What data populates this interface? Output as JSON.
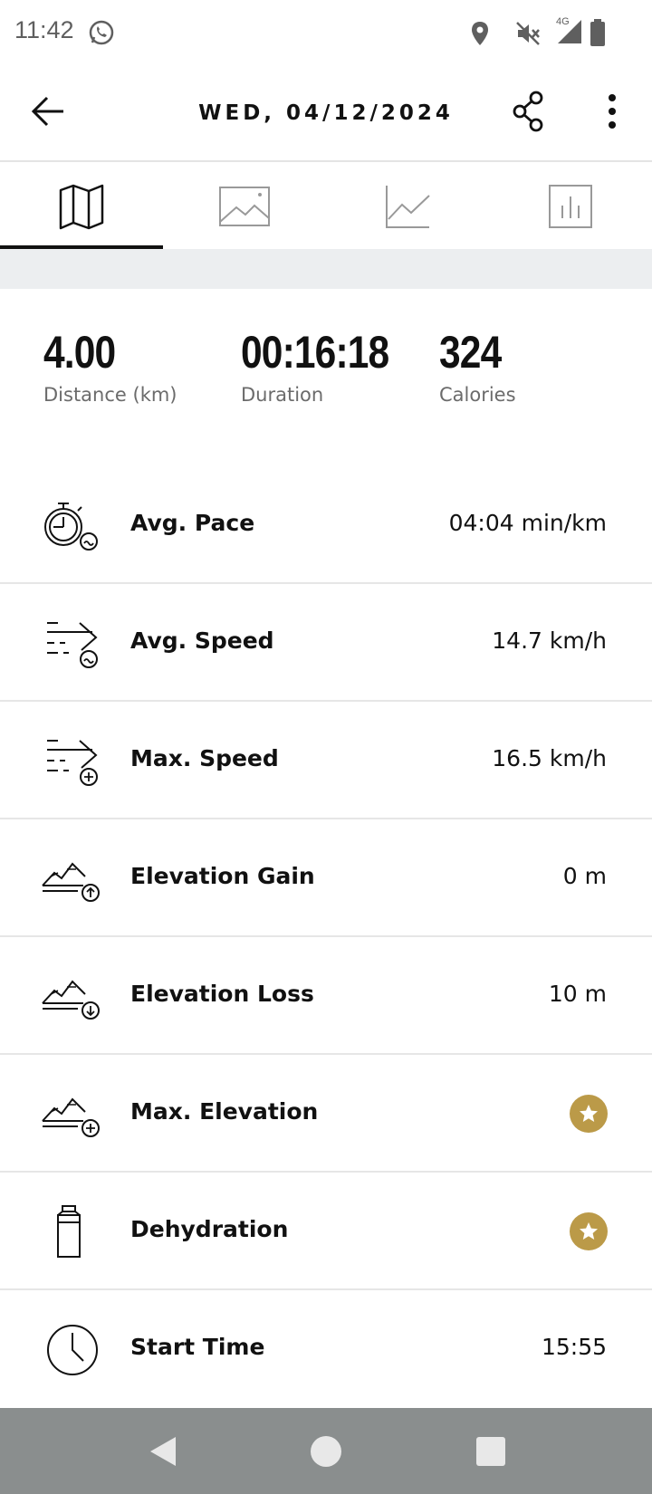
{
  "status_bar": {
    "time": "11:42",
    "icons": [
      "whatsapp-icon",
      "location-icon",
      "mute-icon",
      "signal-4g-icon",
      "battery-icon"
    ],
    "network_label": "4G"
  },
  "app_bar": {
    "title": "WED, 04/12/2024",
    "icons": [
      "back-arrow-icon",
      "share-icon",
      "more-vertical-icon"
    ]
  },
  "tabs": [
    {
      "id": "map",
      "icon": "map-icon",
      "selected": true
    },
    {
      "id": "photos",
      "icon": "image-icon",
      "selected": false
    },
    {
      "id": "graphs",
      "icon": "line-chart-icon",
      "selected": false
    },
    {
      "id": "stats",
      "icon": "bar-chart-icon",
      "selected": false
    }
  ],
  "summary": {
    "distance": {
      "value": "4.00",
      "label": "Distance (km)"
    },
    "duration": {
      "value": "00:16:18",
      "label": "Duration"
    },
    "calories": {
      "value": "324",
      "label": "Calories"
    }
  },
  "metrics": [
    {
      "icon": "stopwatch-pace-icon",
      "label": "Avg. Pace",
      "value": "04:04 min/km"
    },
    {
      "icon": "speed-average-icon",
      "label": "Avg. Speed",
      "value": "14.7 km/h"
    },
    {
      "icon": "speed-max-icon",
      "label": "Max. Speed",
      "value": "16.5 km/h"
    },
    {
      "icon": "elevation-gain-icon",
      "label": "Elevation Gain",
      "value": "0 m"
    },
    {
      "icon": "elevation-loss-icon",
      "label": "Elevation Loss",
      "value": "10 m"
    },
    {
      "icon": "elevation-max-icon",
      "label": "Max. Elevation",
      "premium": true
    },
    {
      "icon": "bottle-icon",
      "label": "Dehydration",
      "premium": true
    },
    {
      "icon": "clock-icon",
      "label": "Start Time",
      "value": "15:55"
    }
  ],
  "colors": {
    "premium_badge": "#bb9a48",
    "tab_indicator": "#111111",
    "nav_bar": "#8a8e8e",
    "divider": "#e6e6e6",
    "gray_band": "#eceef0"
  },
  "nav_bar": {
    "icons": [
      "nav-back-icon",
      "nav-home-icon",
      "nav-recents-icon"
    ]
  }
}
